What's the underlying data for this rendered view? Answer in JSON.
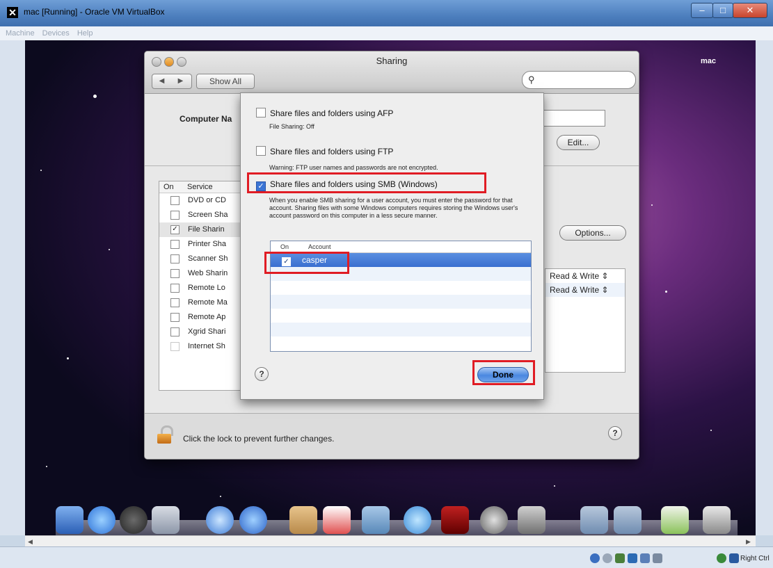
{
  "host_window": {
    "title": "mac [Running] - Oracle VM VirtualBox",
    "menu": [
      "Machine",
      "Devices",
      "Help"
    ],
    "host_key_label": "Right Ctrl"
  },
  "guest": {
    "menubar_name": "mac"
  },
  "sharing": {
    "title": "Sharing",
    "show_all": "Show All",
    "computer_name_label": "Computer Na",
    "edit_button": "Edit...",
    "options_button": "Options...",
    "service_header": {
      "on": "On",
      "service": "Service"
    },
    "services": [
      {
        "label": "DVD or CD",
        "checked": false
      },
      {
        "label": "Screen Sha",
        "checked": false
      },
      {
        "label": "File Sharin",
        "checked": true
      },
      {
        "label": "Printer Sha",
        "checked": false
      },
      {
        "label": "Scanner Sh",
        "checked": false
      },
      {
        "label": "Web Sharin",
        "checked": false
      },
      {
        "label": "Remote Lo",
        "checked": false
      },
      {
        "label": "Remote Ma",
        "checked": false
      },
      {
        "label": "Remote Ap",
        "checked": false
      },
      {
        "label": "Xgrid Shari",
        "checked": false
      },
      {
        "label": "Internet Sh",
        "checked": false
      }
    ],
    "permissions": [
      "Read & Write",
      "Read & Write"
    ],
    "lock_text": "Click the lock to prevent further changes."
  },
  "sheet": {
    "afp_label": "Share files and folders using AFP",
    "afp_status": "File Sharing: Off",
    "ftp_label": "Share files and folders using FTP",
    "ftp_warning": "Warning: FTP user names and passwords are not encrypted.",
    "smb_label": "Share files and folders using SMB (Windows)",
    "smb_description": "When you enable SMB sharing for a user account, you must enter the password for that account. Sharing files with some Windows computers requires storing the Windows user's account password on this computer in a less secure manner.",
    "table_header": {
      "on": "On",
      "account": "Account"
    },
    "accounts": [
      {
        "name": "casper",
        "checked": true
      }
    ],
    "done_button": "Done",
    "checkmark": "✓"
  },
  "colors": {
    "highlight_box": "#e01c24",
    "selection": "#3a6fd0",
    "desktop_purple": "#6a2c7d"
  }
}
